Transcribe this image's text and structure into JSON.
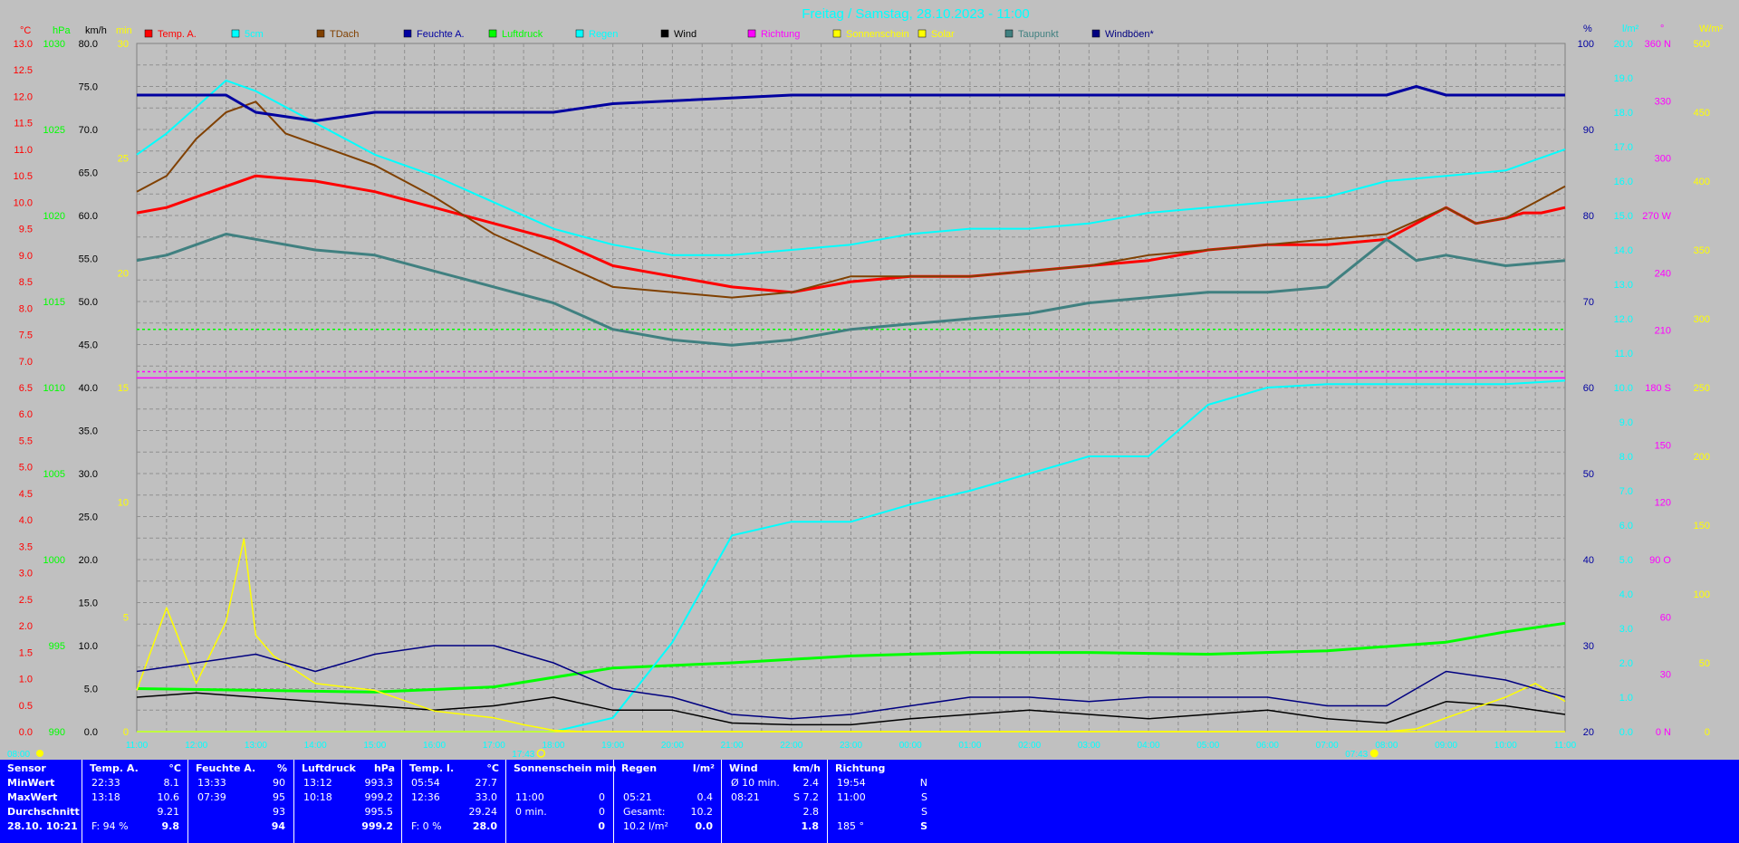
{
  "title": "Freitag / Samstag, 28.10.2023 - 11:00",
  "colors": {
    "background": "#c0c0c0",
    "plot_bg": "#c0c0c0",
    "summary_bg": "#0000ff",
    "grid": "#808080"
  },
  "chart_data": {
    "type": "line",
    "title": "Freitag / Samstag, 28.10.2023 - 11:00",
    "x_ticks": [
      "11:00",
      "12:00",
      "13:00",
      "14:00",
      "15:00",
      "16:00",
      "17:00",
      "18:00",
      "19:00",
      "20:00",
      "21:00",
      "22:00",
      "23:00",
      "00:00",
      "01:00",
      "02:00",
      "03:00",
      "04:00",
      "05:00",
      "06:00",
      "07:00",
      "08:00",
      "09:00",
      "10:00",
      "11:00"
    ],
    "x_range_hours": [
      0,
      24
    ],
    "grid": true,
    "legend": "top",
    "markers": {
      "sunset": "17:43",
      "sunrise": "07:43",
      "left_edge_time": "08:00",
      "left_edge_label": "08:00"
    },
    "axes_left": [
      {
        "unit": "°C",
        "color": "#ff0000",
        "ticks": [
          "0.0",
          "0.5",
          "1.0",
          "1.5",
          "2.0",
          "2.5",
          "3.0",
          "3.5",
          "4.0",
          "4.5",
          "5.0",
          "5.5",
          "6.0",
          "6.5",
          "7.0",
          "7.5",
          "8.0",
          "8.5",
          "9.0",
          "9.5",
          "10.0",
          "10.5",
          "11.0",
          "11.5",
          "12.0",
          "12.5",
          "13.0"
        ]
      },
      {
        "unit": "hPa",
        "color": "#00ff00",
        "ticks": [
          "990",
          "995",
          "1000",
          "1005",
          "1010",
          "1015",
          "1020",
          "1025",
          "1030"
        ]
      },
      {
        "unit": "km/h",
        "color": "#000000",
        "ticks": [
          "0.0",
          "5.0",
          "10.0",
          "15.0",
          "20.0",
          "25.0",
          "30.0",
          "35.0",
          "40.0",
          "45.0",
          "50.0",
          "55.0",
          "60.0",
          "65.0",
          "70.0",
          "75.0",
          "80.0"
        ]
      },
      {
        "unit": "min",
        "color": "#ffff00",
        "ticks": [
          "0",
          "5",
          "10",
          "15",
          "20",
          "25",
          "30"
        ]
      }
    ],
    "axes_right": [
      {
        "unit": "%",
        "color": "#0000a0",
        "ticks": [
          "20",
          "30",
          "40",
          "50",
          "60",
          "70",
          "80",
          "90",
          "100"
        ]
      },
      {
        "unit": "l/m²",
        "color": "#00ffff",
        "ticks": [
          "0.0",
          "1.0",
          "2.0",
          "3.0",
          "4.0",
          "5.0",
          "6.0",
          "7.0",
          "8.0",
          "9.0",
          "10.0",
          "11.0",
          "12.0",
          "13.0",
          "14.0",
          "15.0",
          "16.0",
          "17.0",
          "18.0",
          "19.0",
          "20.0"
        ]
      },
      {
        "unit": "°",
        "color": "#ff00ff",
        "ticks": [
          "0 N",
          "30",
          "60",
          "90 O",
          "120",
          "150",
          "180 S",
          "210",
          "240",
          "270 W",
          "300",
          "330",
          "360 N"
        ]
      },
      {
        "unit": "W/m²",
        "color": "#ffff00",
        "ticks": [
          "0",
          "50",
          "100",
          "150",
          "200",
          "250",
          "300",
          "350",
          "400",
          "450",
          "500"
        ]
      }
    ],
    "series": [
      {
        "name": "Temp. A.",
        "color": "#ff0000",
        "axis": "°C",
        "x": [
          0,
          0.5,
          1,
          1.5,
          2,
          3,
          4,
          5,
          6,
          7,
          8,
          9,
          10,
          11,
          12,
          13,
          14,
          15,
          16,
          17,
          18,
          19,
          20,
          21,
          22,
          22.5,
          23,
          23.3,
          23.6,
          24
        ],
        "y": [
          9.8,
          9.9,
          10.1,
          10.3,
          10.5,
          10.4,
          10.2,
          9.9,
          9.6,
          9.3,
          8.8,
          8.6,
          8.4,
          8.3,
          8.5,
          8.6,
          8.6,
          8.7,
          8.8,
          8.9,
          9.1,
          9.2,
          9.2,
          9.3,
          9.9,
          9.6,
          9.7,
          9.8,
          9.8,
          9.9
        ]
      },
      {
        "name": "5cm",
        "color": "#00ffff",
        "axis": "°C",
        "x": [
          0,
          0.5,
          1,
          1.5,
          2,
          3,
          4,
          5,
          6,
          7,
          8,
          9,
          10,
          11,
          12,
          13,
          14,
          15,
          16,
          17,
          18,
          19,
          20,
          21,
          22,
          23,
          23.5,
          24
        ],
        "y": [
          10.9,
          11.3,
          11.8,
          12.3,
          12.1,
          11.5,
          10.9,
          10.5,
          10.0,
          9.5,
          9.2,
          9.0,
          9.0,
          9.1,
          9.2,
          9.4,
          9.5,
          9.5,
          9.6,
          9.8,
          9.9,
          10.0,
          10.1,
          10.4,
          10.5,
          10.6,
          10.8,
          11.0
        ]
      },
      {
        "name": "TDach",
        "color": "#804000",
        "axis": "°C",
        "x": [
          0,
          0.5,
          1,
          1.5,
          2,
          2.5,
          3,
          4,
          5,
          6,
          7,
          8,
          9,
          10,
          11,
          12,
          13,
          14,
          15,
          16,
          17,
          18,
          19,
          20,
          21,
          22,
          22.5,
          23,
          23.5,
          24
        ],
        "y": [
          10.2,
          10.5,
          11.2,
          11.7,
          11.9,
          11.3,
          11.1,
          10.7,
          10.1,
          9.4,
          8.9,
          8.4,
          8.3,
          8.2,
          8.3,
          8.6,
          8.6,
          8.6,
          8.7,
          8.8,
          9.0,
          9.1,
          9.2,
          9.3,
          9.4,
          9.9,
          9.6,
          9.7,
          10.0,
          10.3
        ]
      },
      {
        "name": "Feuchte A.",
        "color": "#0000a0",
        "axis": "%",
        "x": [
          0,
          1.5,
          2,
          3,
          4,
          5,
          7,
          8,
          11,
          12,
          21,
          21.5,
          22,
          24
        ],
        "y": [
          94,
          94,
          92,
          91,
          92,
          92,
          92,
          93,
          94,
          94,
          94,
          95,
          94,
          94
        ]
      },
      {
        "name": "Luftdruck",
        "color": "#00ff00",
        "axis": "hPa",
        "x": [
          0,
          2,
          4,
          6,
          8,
          10,
          12,
          14,
          16,
          18,
          20,
          22,
          23,
          24
        ],
        "y": [
          992.5,
          992.4,
          992.3,
          992.6,
          993.7,
          994.0,
          994.4,
          994.6,
          994.6,
          994.5,
          994.7,
          995.2,
          995.8,
          996.3
        ]
      },
      {
        "name": "Regen",
        "color": "#00ffff",
        "axis": "l/m²",
        "x": [
          0,
          7,
          8,
          9,
          10,
          11,
          12,
          13,
          14,
          15,
          16,
          17,
          18,
          19,
          20,
          21,
          22,
          23,
          24
        ],
        "y": [
          0,
          0,
          0.4,
          2.6,
          5.7,
          6.1,
          6.1,
          6.6,
          7.0,
          7.5,
          8.0,
          8.0,
          9.5,
          10.0,
          10.1,
          10.1,
          10.1,
          10.1,
          10.2
        ]
      },
      {
        "name": "Wind",
        "color": "#000000",
        "axis": "km/h",
        "x": [
          0,
          1,
          2,
          3,
          4,
          5,
          6,
          7,
          8,
          9,
          10,
          11,
          12,
          13,
          14,
          15,
          16,
          17,
          18,
          19,
          20,
          21,
          22,
          23,
          24
        ],
        "y": [
          4,
          4.5,
          4,
          3.5,
          3,
          2.5,
          3,
          4,
          2.5,
          2.5,
          1,
          0.8,
          0.8,
          1.5,
          2,
          2.5,
          2,
          1.5,
          2,
          2.5,
          1.5,
          1,
          3.5,
          3,
          2
        ]
      },
      {
        "name": "Richtung",
        "color": "#ff00ff",
        "axis": "°",
        "x": [
          0,
          24
        ],
        "y": [
          185,
          185
        ]
      },
      {
        "name": "Sonnenschein",
        "color": "#ffff00",
        "axis": "min",
        "x": [
          0,
          24
        ],
        "y": [
          0,
          0
        ]
      },
      {
        "name": "Solar",
        "color": "#ffff00",
        "axis": "W/m²",
        "x": [
          0,
          0.5,
          1,
          1.5,
          1.8,
          2,
          2.3,
          3,
          4,
          5,
          6,
          6.5,
          7,
          7.5,
          21,
          21.5,
          22,
          23,
          23.5,
          24
        ],
        "y": [
          30,
          90,
          35,
          80,
          140,
          70,
          55,
          35,
          30,
          15,
          10,
          5,
          1,
          0,
          0,
          2,
          10,
          25,
          35,
          22
        ]
      },
      {
        "name": "Taupunkt",
        "color": "#408080",
        "axis": "°C",
        "x": [
          0,
          0.5,
          1,
          1.5,
          2,
          3,
          4,
          5,
          6,
          7,
          8,
          9,
          10,
          11,
          12,
          13,
          14,
          15,
          16,
          17,
          18,
          19,
          20,
          21,
          21.5,
          22,
          23,
          24
        ],
        "y": [
          8.9,
          9.0,
          9.2,
          9.4,
          9.3,
          9.1,
          9.0,
          8.7,
          8.4,
          8.1,
          7.6,
          7.4,
          7.3,
          7.4,
          7.6,
          7.7,
          7.8,
          7.9,
          8.1,
          8.2,
          8.3,
          8.3,
          8.4,
          9.3,
          8.9,
          9.0,
          8.8,
          8.9
        ]
      },
      {
        "name": "Windböen*",
        "color": "#000080",
        "axis": "km/h",
        "x": [
          0,
          1,
          2,
          3,
          4,
          5,
          6,
          7,
          8,
          9,
          10,
          11,
          12,
          13,
          14,
          15,
          16,
          17,
          18,
          19,
          20,
          21,
          22,
          23,
          24
        ],
        "y": [
          7,
          8,
          9,
          7,
          9,
          10,
          10,
          8,
          5,
          4,
          2,
          1.5,
          2,
          3,
          4,
          4,
          3.5,
          4,
          4,
          4,
          3,
          3,
          7,
          6,
          4
        ]
      }
    ],
    "reference_lines": [
      {
        "axis": "°C",
        "value": 7.6,
        "color": "#00ff00"
      },
      {
        "axis": "°C",
        "value": 6.8,
        "color": "#ff00ff"
      }
    ]
  },
  "summary": {
    "columns": [
      {
        "head": "Sensor",
        "unit": "",
        "rows": [
          {
            "label": "MinWert",
            "time": "",
            "value": ""
          },
          {
            "label": "MaxWert",
            "time": "",
            "value": ""
          },
          {
            "label": "Durchschnitt",
            "time": "",
            "value": ""
          },
          {
            "label": "28.10. 10:21",
            "time": "",
            "value": ""
          }
        ]
      },
      {
        "head": "Temp. A.",
        "unit": "°C",
        "rows": [
          {
            "time": "22:33",
            "value": "8.1"
          },
          {
            "time": "13:18",
            "value": "10.6"
          },
          {
            "time": "",
            "value": "9.21"
          },
          {
            "time": "F: 94 %",
            "value": "9.8"
          }
        ]
      },
      {
        "head": "Feuchte A.",
        "unit": "%",
        "rows": [
          {
            "time": "13:33",
            "value": "90"
          },
          {
            "time": "07:39",
            "value": "95"
          },
          {
            "time": "",
            "value": "93"
          },
          {
            "time": "",
            "value": "94"
          }
        ]
      },
      {
        "head": "Luftdruck",
        "unit": "hPa",
        "rows": [
          {
            "time": "13:12",
            "value": "993.3"
          },
          {
            "time": "10:18",
            "value": "999.2"
          },
          {
            "time": "",
            "value": "995.5"
          },
          {
            "time": "",
            "value": "999.2"
          }
        ]
      },
      {
        "head": "Temp. I.",
        "unit": "°C",
        "rows": [
          {
            "time": "05:54",
            "value": "27.7"
          },
          {
            "time": "12:36",
            "value": "33.0"
          },
          {
            "time": "",
            "value": "29.24"
          },
          {
            "time": "F: 0 %",
            "value": "28.0"
          }
        ]
      },
      {
        "head": "Sonnenschein min",
        "unit": "",
        "rows": [
          {
            "time": "",
            "value": ""
          },
          {
            "time": "11:00",
            "value": "0"
          },
          {
            "time": "0 min.",
            "value": "0"
          },
          {
            "time": "",
            "value": "0"
          }
        ]
      },
      {
        "head": "Regen",
        "unit": "l/m²",
        "rows": [
          {
            "time": "",
            "value": ""
          },
          {
            "time": "05:21",
            "value": "0.4"
          },
          {
            "time": "Gesamt:",
            "value": "10.2"
          },
          {
            "time": "10.2 l/m²",
            "value": "0.0"
          }
        ]
      },
      {
        "head": "Wind",
        "unit": "km/h",
        "rows": [
          {
            "time": "Ø 10 min.",
            "value": "2.4"
          },
          {
            "time": "08:21",
            "value": "S 7.2"
          },
          {
            "time": "",
            "value": "2.8"
          },
          {
            "time": "",
            "value": "1.8"
          }
        ]
      },
      {
        "head": "Richtung",
        "unit": "",
        "rows": [
          {
            "time": "19:54",
            "value": "N"
          },
          {
            "time": "11:00",
            "value": "S"
          },
          {
            "time": "",
            "value": "S"
          },
          {
            "time": "185 °",
            "value": "S"
          }
        ]
      }
    ]
  }
}
